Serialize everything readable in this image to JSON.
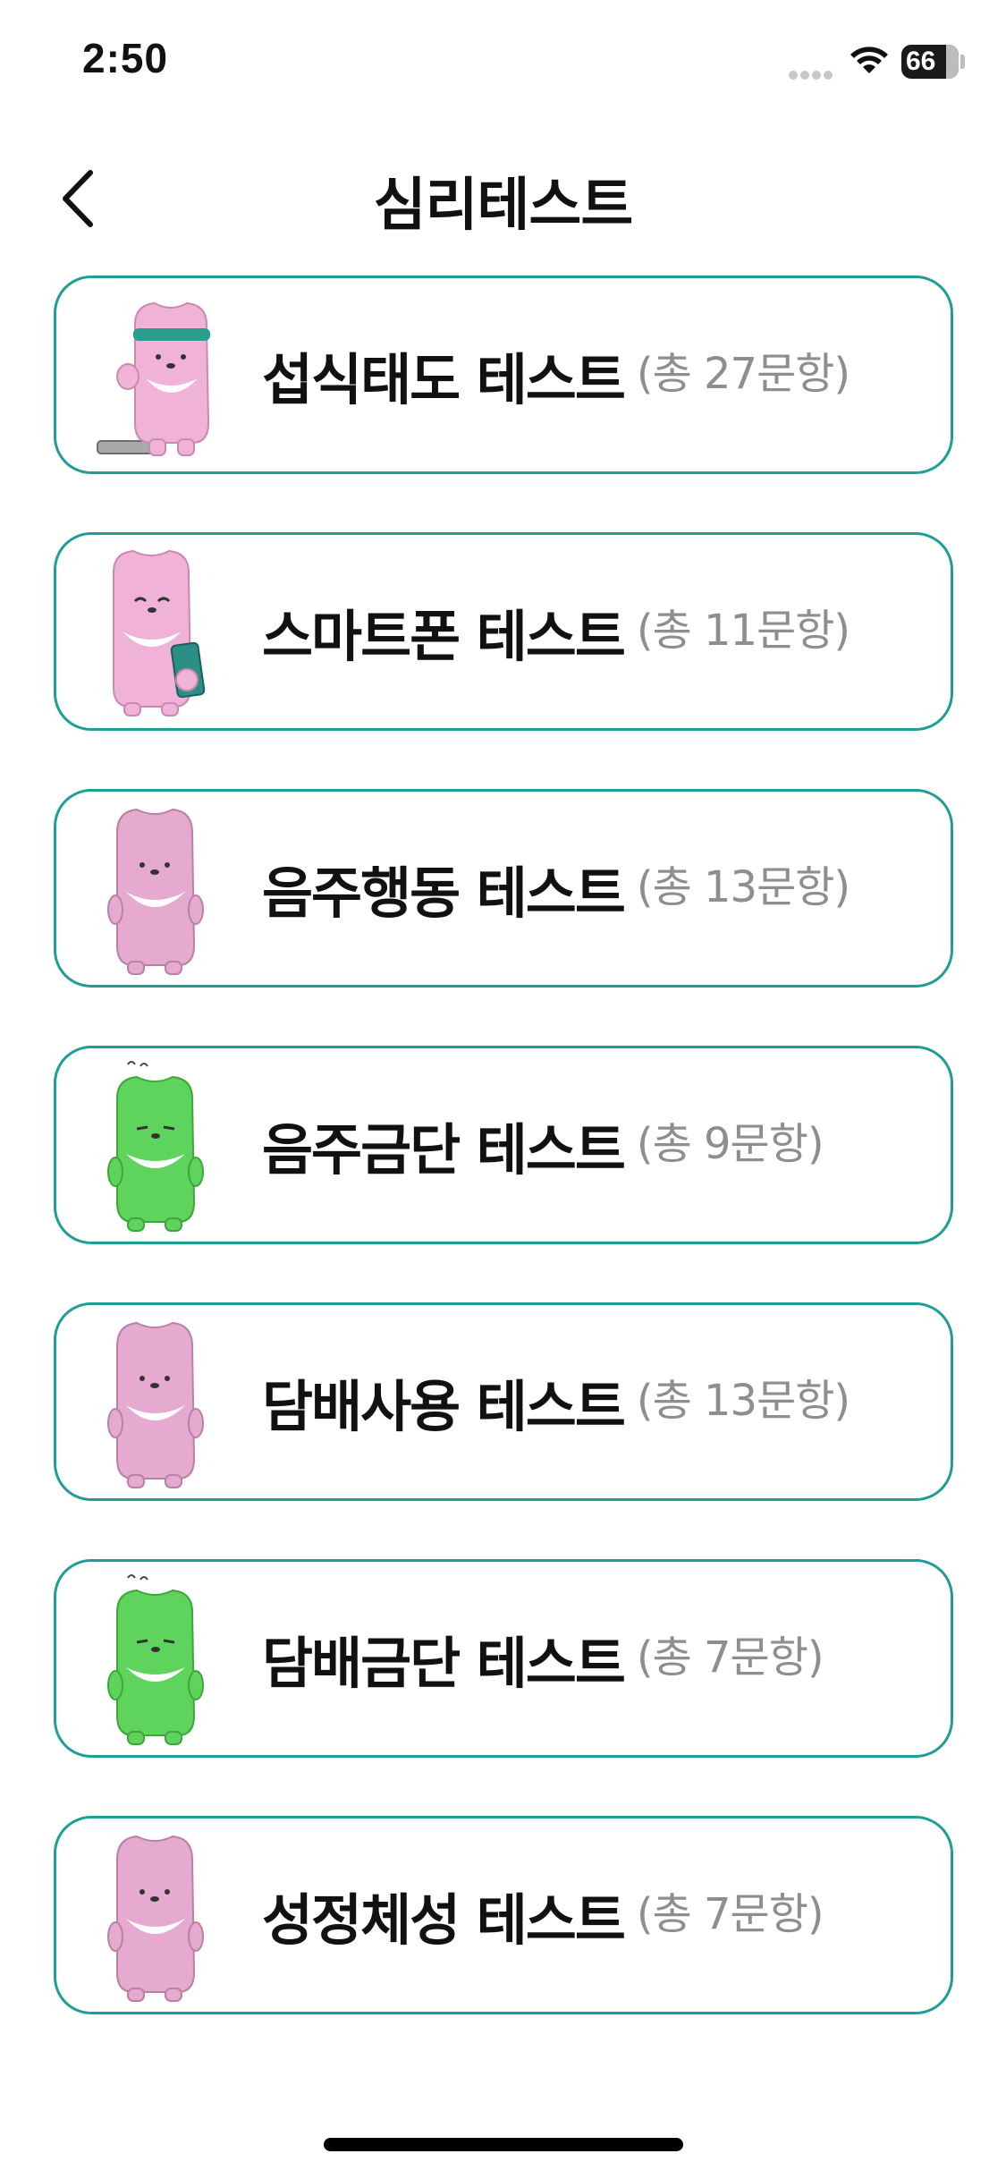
{
  "status_bar": {
    "time": "2:50",
    "battery": "66"
  },
  "header": {
    "title": "심리테스트",
    "back_icon": "chevron-left-icon"
  },
  "colors": {
    "card_border": "#1f9e97",
    "count_text": "#8e8e8e",
    "mascot_pink": "#e6a9cf",
    "mascot_green": "#5fd45c"
  },
  "tests": [
    {
      "title": "섭식태도 테스트",
      "count": "(총 27문항)",
      "mascot": "pink-bear-exercise"
    },
    {
      "title": "스마트폰 테스트",
      "count": "(총 11문항)",
      "mascot": "pink-bear-phone"
    },
    {
      "title": "음주행동 테스트",
      "count": "(총 13문항)",
      "mascot": "pink-bear"
    },
    {
      "title": "음주금단 테스트",
      "count": "(총 9문항)",
      "mascot": "green-bear"
    },
    {
      "title": "담배사용 테스트",
      "count": "(총 13문항)",
      "mascot": "pink-bear"
    },
    {
      "title": "담배금단 테스트",
      "count": "(총 7문항)",
      "mascot": "green-bear"
    },
    {
      "title": "성정체성 테스트",
      "count": "(총 7문항)",
      "mascot": "pink-bear"
    }
  ]
}
